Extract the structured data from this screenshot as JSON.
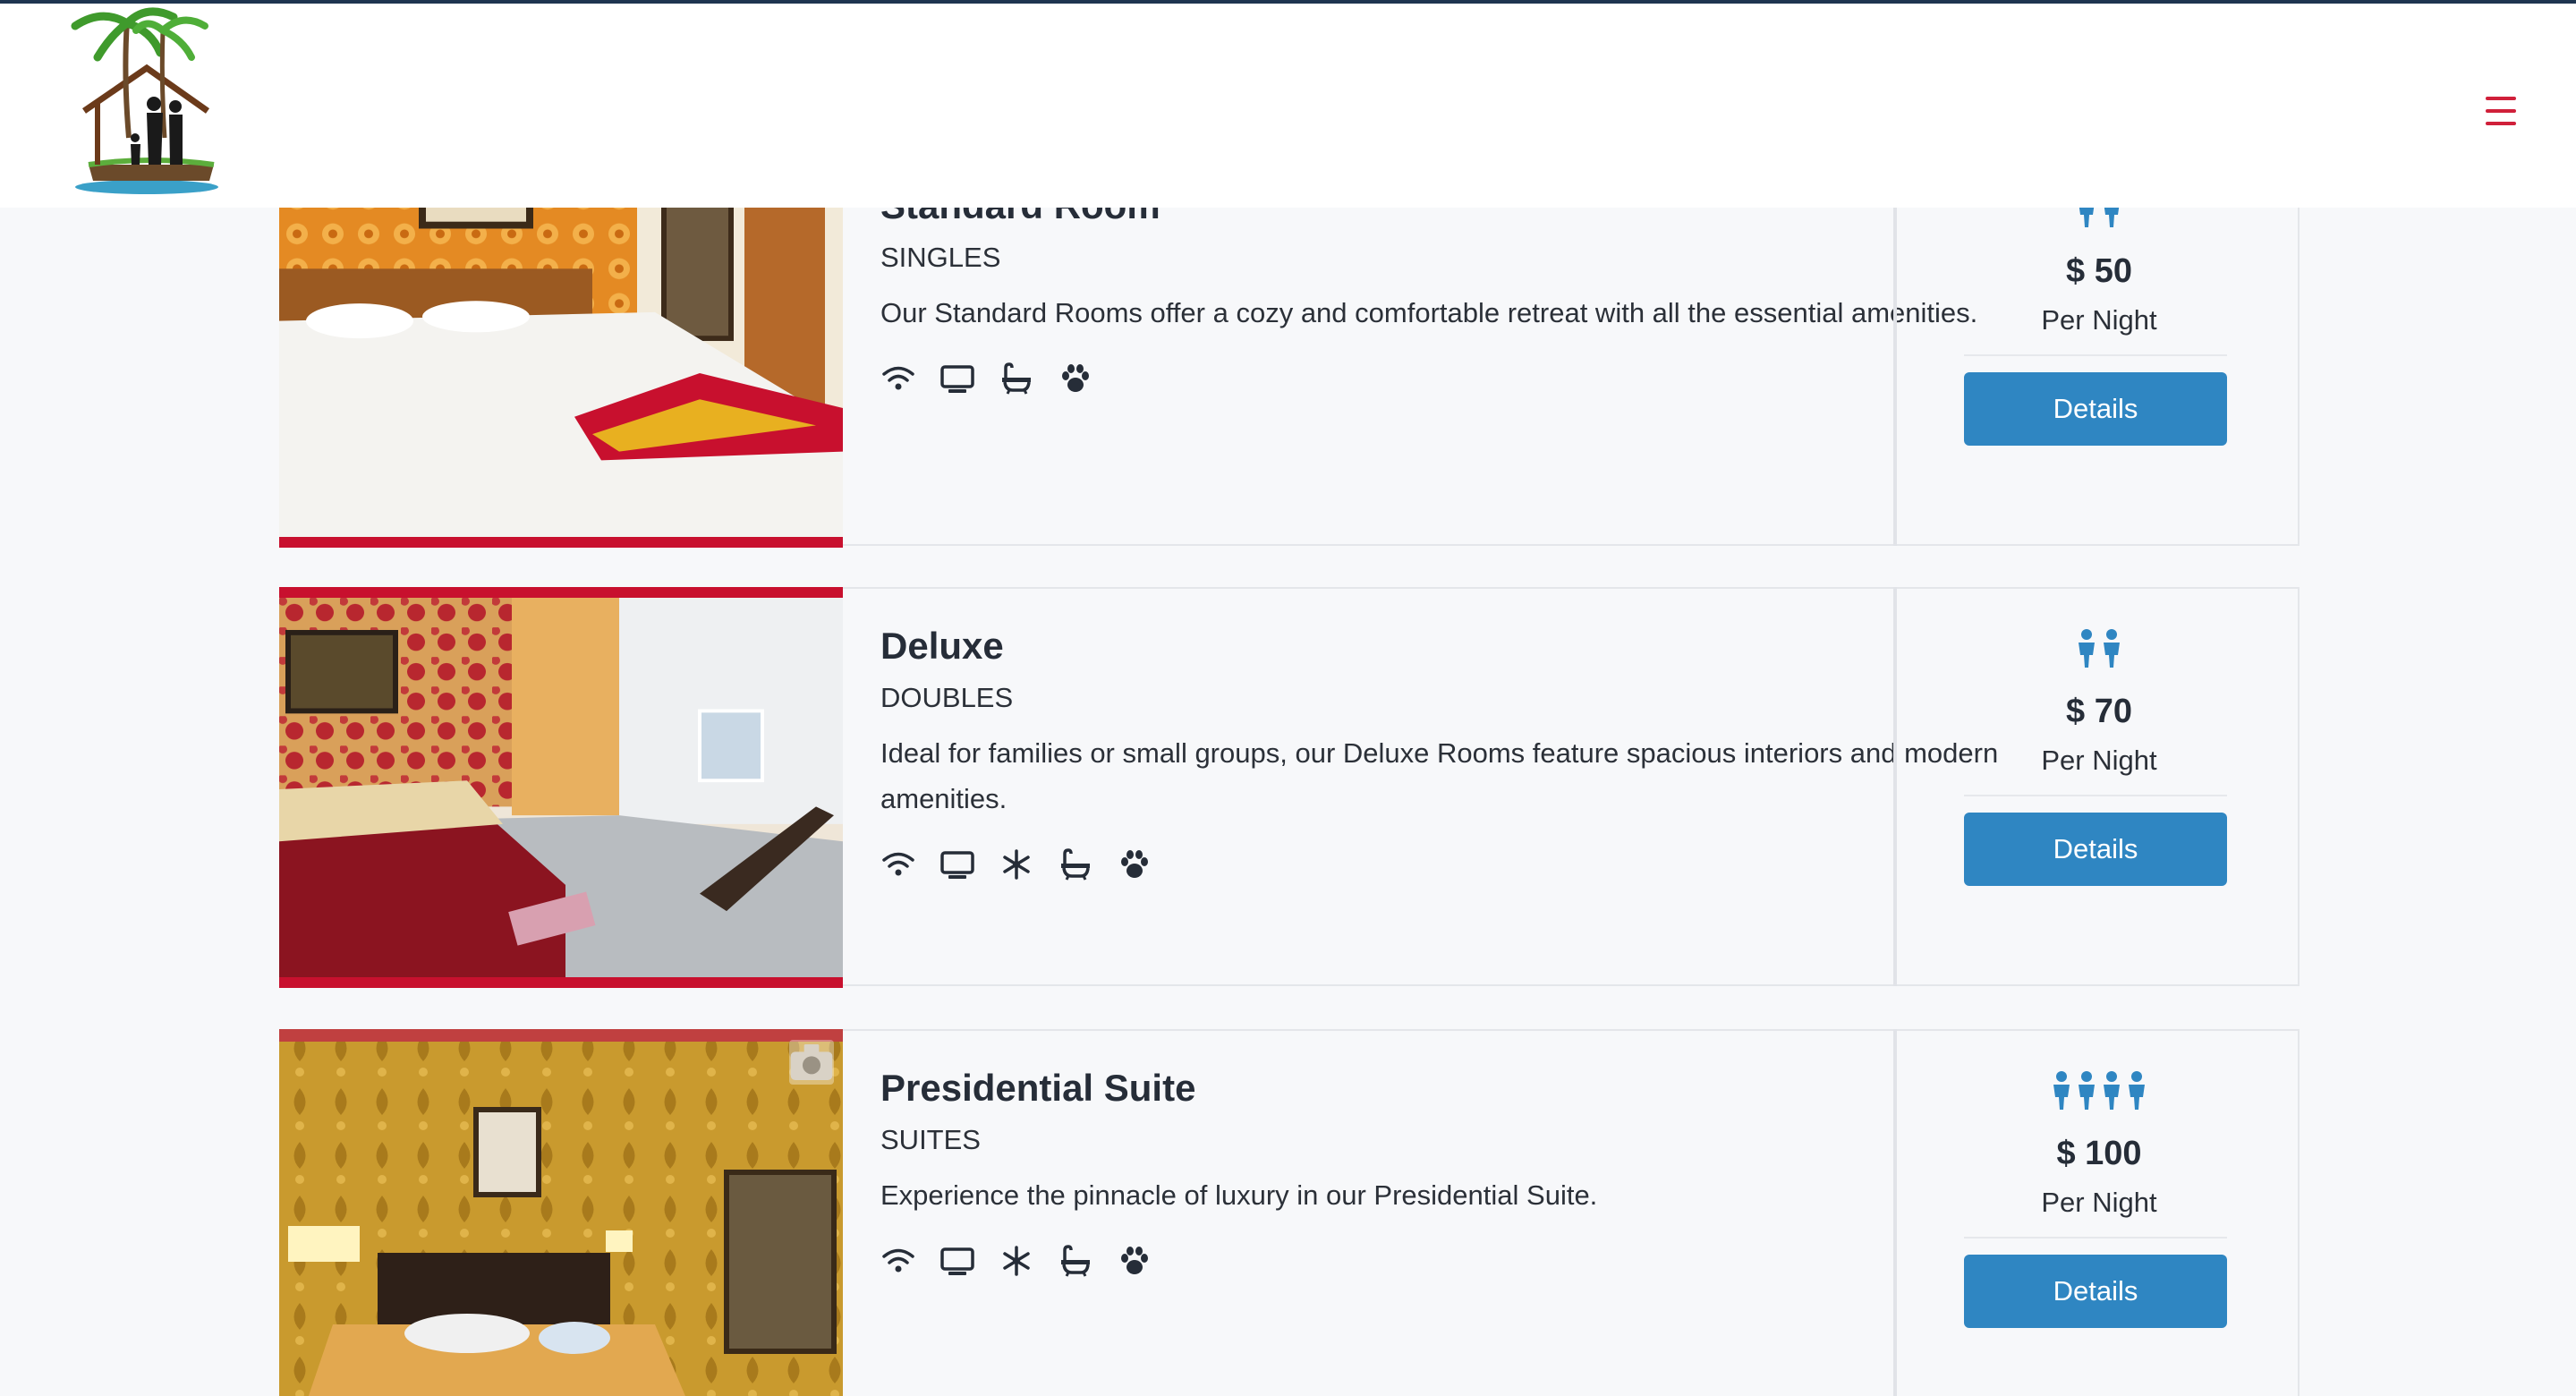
{
  "header": {
    "logo_icon": "palm-family-home-logo",
    "menu_icon": "hamburger-menu-icon",
    "accent_color": "#d0203a"
  },
  "rooms": [
    {
      "name": "Standard Room",
      "category": "SINGLES",
      "description": "Our Standard Rooms offer a cozy and comfortable retreat with all the essential amenities.",
      "amenities": [
        "wifi-icon",
        "tv-icon",
        "bathtub-icon",
        "pet-paw-icon"
      ],
      "guests": 2,
      "price": "$ 50",
      "per_night": "Per Night",
      "details_label": "Details"
    },
    {
      "name": "Deluxe",
      "category": "DOUBLES",
      "description": "Ideal for families or small groups, our Deluxe Rooms feature spacious interiors and modern amenities.",
      "amenities": [
        "wifi-icon",
        "tv-icon",
        "snowflake-ac-icon",
        "bathtub-icon",
        "pet-paw-icon"
      ],
      "guests": 2,
      "price": "$ 70",
      "per_night": "Per Night",
      "details_label": "Details"
    },
    {
      "name": "Presidential Suite",
      "category": "SUITES",
      "description": "Experience the pinnacle of luxury in our Presidential Suite.",
      "amenities": [
        "wifi-icon",
        "tv-icon",
        "snowflake-ac-icon",
        "bathtub-icon",
        "pet-paw-icon"
      ],
      "guests": 4,
      "price": "$ 100",
      "per_night": "Per Night",
      "details_label": "Details"
    }
  ],
  "colors": {
    "button": "#2f86c2",
    "guest_icon": "#2f86c2",
    "photo_border": "#c8102e"
  }
}
